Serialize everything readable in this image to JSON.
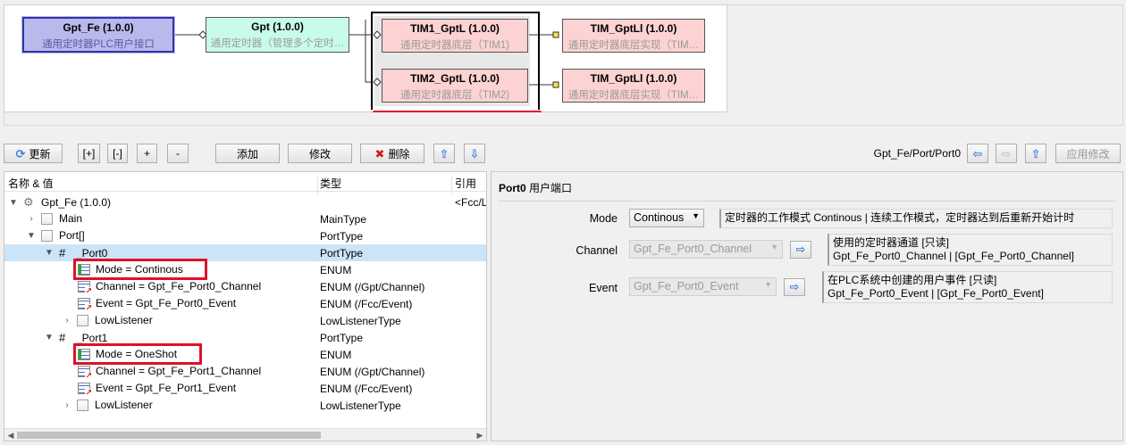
{
  "diagram": {
    "nodes": {
      "fe": {
        "title": "Gpt_Fe (1.0.0)",
        "subtitle": "通用定时器PLC用户接口"
      },
      "gpt": {
        "title": "Gpt (1.0.0)",
        "subtitle": "通用定时器（管理多个定时…"
      },
      "tim1": {
        "title": "TIM1_GptL (1.0.0)",
        "subtitle": "通用定时器底层（TIM1)"
      },
      "tim2": {
        "title": "TIM2_GptL (1.0.0)",
        "subtitle": "通用定时器底层（TIM2)"
      },
      "ll1": {
        "title": "TIM_GptLl (1.0.0)",
        "subtitle": "通用定时器底层实现（TIM…"
      },
      "ll2": {
        "title": "TIM_GptLl (1.0.0)",
        "subtitle": "通用定时器底层实现（TIM…"
      }
    },
    "colors": {
      "fe": "#b9b9ec",
      "gpt": "#c8fbec",
      "tim": "#fcd2d2",
      "highlight": "#e0102a"
    }
  },
  "toolbar": {
    "refresh": "更新",
    "expand": "[+]",
    "collapse": "[-]",
    "plus": "+",
    "minus": "-",
    "add": "添加",
    "modify": "修改",
    "delete": "删除",
    "path": "Gpt_Fe/Port/Port0",
    "apply": "应用修改"
  },
  "tree": {
    "headers": {
      "name": "名称 & 值",
      "type": "类型",
      "ref": "引用"
    },
    "rows": [
      {
        "label": "Gpt_Fe (1.0.0)",
        "type": "",
        "ref": "<Fcc/Ll"
      },
      {
        "label": "Main",
        "type": "MainType",
        "ref": ""
      },
      {
        "label": "Port[]",
        "type": "PortType",
        "ref": ""
      },
      {
        "label": "_Port0",
        "type": "PortType",
        "ref": ""
      },
      {
        "label": "Mode = Continous",
        "type": "ENUM",
        "ref": ""
      },
      {
        "label": "Channel = Gpt_Fe_Port0_Channel",
        "type": "ENUM (/Gpt/Channel)",
        "ref": ""
      },
      {
        "label": "Event = Gpt_Fe_Port0_Event",
        "type": "ENUM (/Fcc/Event)",
        "ref": ""
      },
      {
        "label": "LowListener",
        "type": "LowListenerType",
        "ref": ""
      },
      {
        "label": "_Port1",
        "type": "PortType",
        "ref": ""
      },
      {
        "label": "Mode = OneShot",
        "type": "ENUM",
        "ref": ""
      },
      {
        "label": "Channel = Gpt_Fe_Port1_Channel",
        "type": "ENUM (/Gpt/Channel)",
        "ref": ""
      },
      {
        "label": "Event = Gpt_Fe_Port1_Event",
        "type": "ENUM (/Fcc/Event)",
        "ref": ""
      },
      {
        "label": "LowListener",
        "type": "LowListenerType",
        "ref": ""
      }
    ],
    "selected_row": "_Port0"
  },
  "props": {
    "title_bold": "Port0",
    "title_rest": " 用户端口",
    "mode": {
      "label": "Mode",
      "value": "Continous",
      "desc": "定时器的工作模式 Continous | 连续工作模式，定时器达到后重新开始计时"
    },
    "channel": {
      "label": "Channel",
      "value": "Gpt_Fe_Port0_Channel",
      "desc1": "使用的定时器通道 [只读]",
      "desc2": "Gpt_Fe_Port0_Channel | [Gpt_Fe_Port0_Channel]"
    },
    "event": {
      "label": "Event",
      "value": "Gpt_Fe_Port0_Event",
      "desc1": "在PLC系统中创建的用户事件 [只读]",
      "desc2": "Gpt_Fe_Port0_Event | [Gpt_Fe_Port0_Event]"
    }
  }
}
